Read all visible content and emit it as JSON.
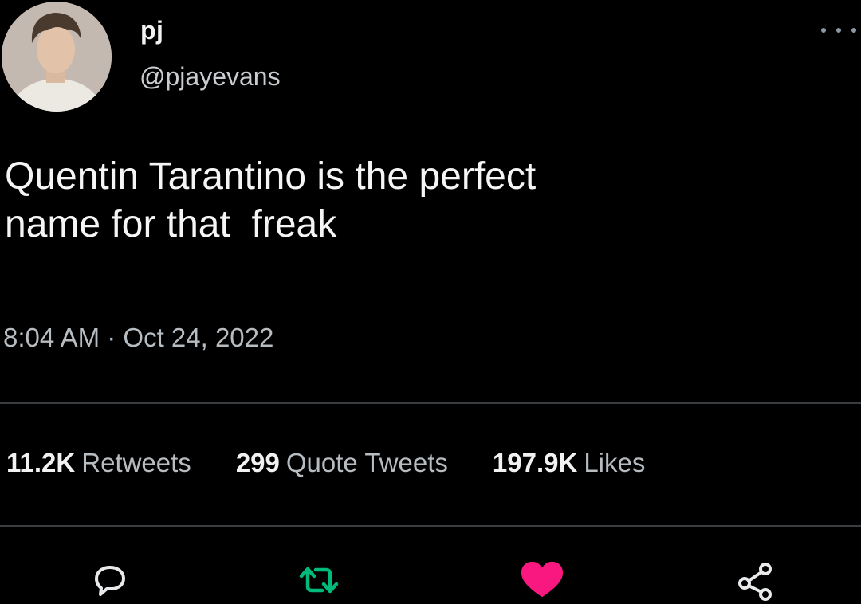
{
  "author": {
    "display_name": "pj",
    "handle": "@pjayevans"
  },
  "tweet": {
    "text": "Quentin Tarantino is the perfect\nname for that  freak",
    "timestamp": "8:04 AM · Oct 24, 2022"
  },
  "stats": {
    "retweets_count": "11.2K",
    "retweets_label": "Retweets",
    "quotes_count": "299",
    "quotes_label": "Quote Tweets",
    "likes_count": "197.9K",
    "likes_label": "Likes"
  },
  "actions": {
    "reply_icon": "reply-icon",
    "retweet_icon": "retweet-icon",
    "like_icon": "heart-icon",
    "share_icon": "share-icon"
  },
  "colors": {
    "background": "#000000",
    "retweet_active": "#00ba7c",
    "like_active": "#f91880",
    "muted_text": "#b7bcc1",
    "divider": "#3a3d40"
  }
}
